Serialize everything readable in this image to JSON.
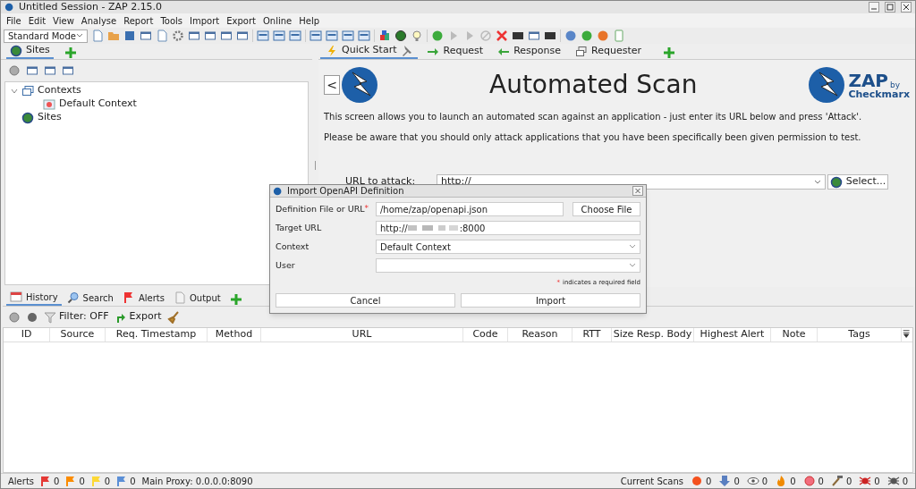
{
  "window": {
    "title": "Untitled Session - ZAP 2.15.0"
  },
  "menu": [
    "File",
    "Edit",
    "View",
    "Analyse",
    "Report",
    "Tools",
    "Import",
    "Export",
    "Online",
    "Help"
  ],
  "mode_select": {
    "value": "Standard Mode"
  },
  "sites_panel": {
    "tabs": [
      {
        "label": "Sites",
        "selected": true
      }
    ],
    "tree": [
      {
        "label": "Contexts",
        "kind": "contexts",
        "expanded": true,
        "children": [
          {
            "label": "Default Context",
            "kind": "context"
          }
        ]
      },
      {
        "label": "Sites",
        "kind": "sites"
      }
    ]
  },
  "work_tabs": [
    {
      "label": "Quick Start",
      "kind": "bolt",
      "selected": true,
      "pinned": true
    },
    {
      "label": "Request",
      "kind": "right-arrow",
      "selected": false,
      "pinned": false
    },
    {
      "label": "Response",
      "kind": "left-arrow",
      "selected": false,
      "pinned": false
    },
    {
      "label": "Requester",
      "kind": "windows",
      "selected": false,
      "pinned": false
    }
  ],
  "quick_start": {
    "back": "<",
    "title": "Automated Scan",
    "logo_text": "ZAP",
    "logo_by": "by",
    "logo_brand": "Checkmarx",
    "paragraphs": [
      "This screen allows you to launch an automated scan against  an application - just enter its URL below and press 'Attack'.",
      "Please be aware that you should only attack applications that you have been specifically been given permission to test."
    ],
    "url_label": "URL to attack:",
    "url_value": "http://",
    "select_button": "Select..."
  },
  "dialog": {
    "title": "Import OpenAPI Definition",
    "required_mark": "*",
    "fields": [
      {
        "label": "Definition File or URL",
        "kind": "text",
        "required": true,
        "value": "/home/zap/openapi.json",
        "button": "Choose File"
      },
      {
        "label": "Target URL",
        "kind": "redacted",
        "required": false,
        "value_prefix": "http://",
        "value_suffix": ":8000"
      },
      {
        "label": "Context",
        "kind": "select",
        "required": false,
        "value": "Default Context"
      },
      {
        "label": "User",
        "kind": "select",
        "required": false
      }
    ],
    "note": "indicates a required field",
    "buttons": [
      "Cancel",
      "Import"
    ]
  },
  "bottom_tabs": [
    {
      "label": "History",
      "kind": "calendar",
      "selected": true
    },
    {
      "label": "Search",
      "kind": "search",
      "selected": false
    },
    {
      "label": "Alerts",
      "kind": "flag",
      "selected": false
    },
    {
      "label": "Output",
      "kind": "page",
      "selected": false
    }
  ],
  "history_toolbar": {
    "filter": "Filter: OFF",
    "export": "Export"
  },
  "table": {
    "columns": [
      "ID",
      "Source",
      "Req. Timestamp",
      "Method",
      "URL",
      "Code",
      "Reason",
      "RTT",
      "Size Resp. Body",
      "Highest Alert",
      "Note",
      "Tags"
    ]
  },
  "status_bar": {
    "alerts_label": "Alerts",
    "alert_counts": [
      {
        "color": "#e53935",
        "count": "0"
      },
      {
        "color": "#fb8c00",
        "count": "0"
      },
      {
        "color": "#fdd835",
        "count": "0"
      },
      {
        "color": "#5b8fd6",
        "count": "0"
      }
    ],
    "proxy": "Main Proxy: 0.0.0.0:8090",
    "scans_label": "Current Scans",
    "scan_counts": [
      {
        "kind": "dot",
        "count": "0"
      },
      {
        "kind": "arrow",
        "count": "0"
      },
      {
        "kind": "eye",
        "count": "0"
      },
      {
        "kind": "flame",
        "count": "0"
      },
      {
        "kind": "circle",
        "count": "0"
      },
      {
        "kind": "hammer",
        "count": "0"
      },
      {
        "kind": "bug",
        "count": "0"
      },
      {
        "kind": "bug-gray",
        "count": "0"
      }
    ]
  }
}
